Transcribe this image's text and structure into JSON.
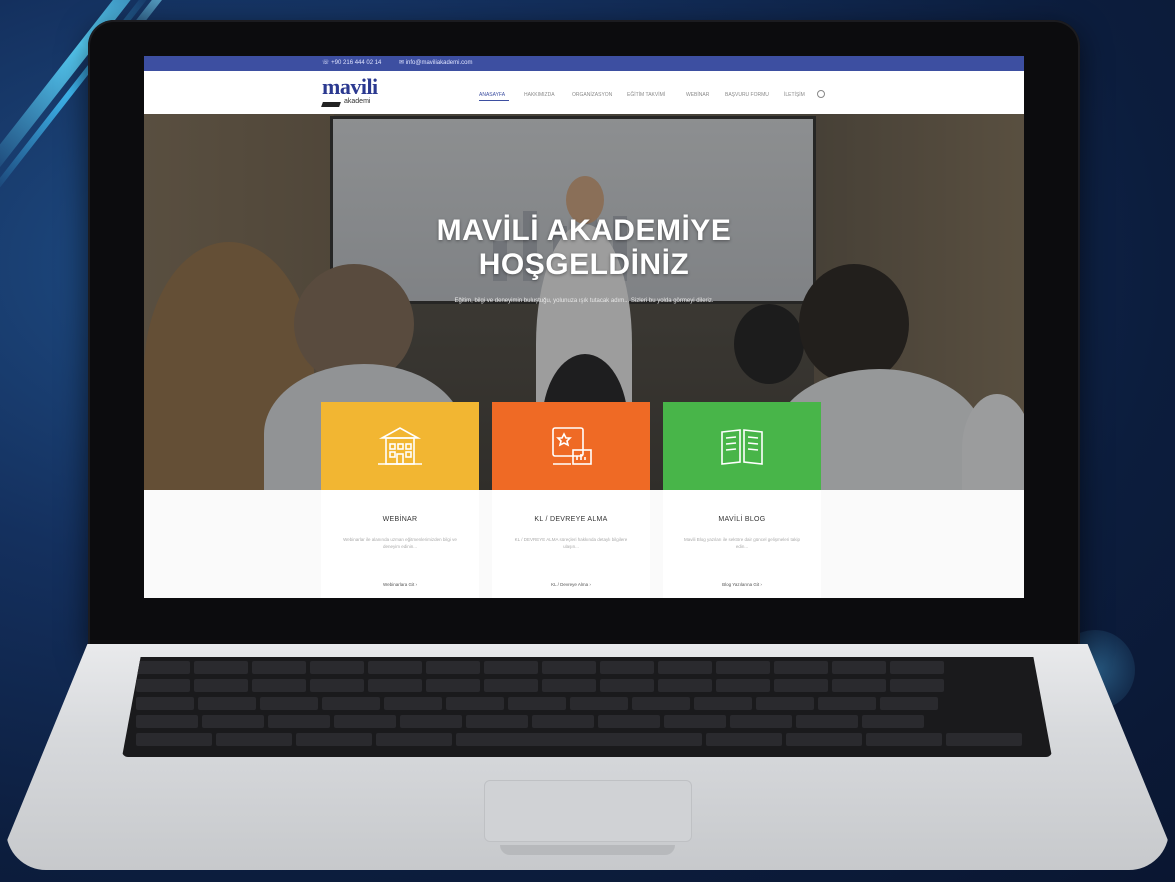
{
  "topbar": {
    "phone": "☏ +90 216 444 02 14",
    "email": "✉ info@maviliakademi.com"
  },
  "brand": {
    "logo_word": "mavili",
    "logo_sub": "akademi"
  },
  "nav": {
    "items": [
      "ANASAYFA",
      "HAKKIMIZDA",
      "ORGANİZASYON",
      "EĞİTİM TAKVİMİ",
      "WEBİNAR",
      "BAŞVURU FORMU",
      "İLETİŞİM"
    ]
  },
  "hero": {
    "title_line1": "MAVİLİ AKADEMİYE",
    "title_line2": "HOŞGELDİNİZ",
    "subtitle": "Eğitim, bilgi ve deneyimin buluştuğu, yolunuza ışık tutacak adım... Sizleri bu yolda görmeyi dileriz."
  },
  "cards": [
    {
      "title": "WEBİNAR",
      "desc": "Webinarlar ile alanında uzman eğitmenlerimizden bilgi ve deneyim edinin...",
      "link": "Webinarlara Git ›",
      "color": "#f2b632"
    },
    {
      "title": "KL / DEVREYE ALMA",
      "desc": "KL / DEVREYE ALMA süreçleri hakkında detaylı bilgilere ulaşın...",
      "link": "KL / Devreye Alma ›",
      "color": "#ef6a25"
    },
    {
      "title": "MAVİLİ BLOG",
      "desc": "Mavili Blog yazıları ile sektöre dair güncel gelişmeleri takip edin...",
      "link": "Blog Yazılarına Git ›",
      "color": "#48b549"
    }
  ]
}
